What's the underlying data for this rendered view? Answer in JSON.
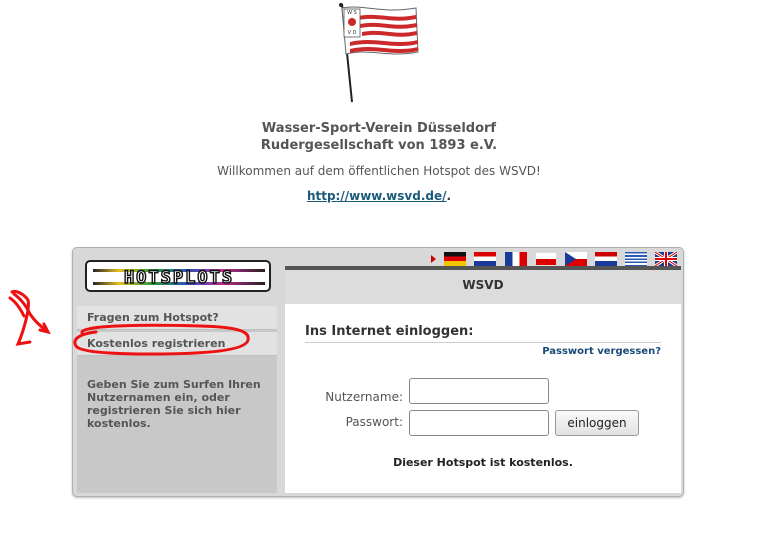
{
  "club": {
    "name_line1": "Wasser-Sport-Verein Düsseldorf",
    "name_line2": "Rudergesellschaft von 1893 e.V.",
    "welcome": "Willkommen auf dem öffentlichen Hotspot des WSVD!",
    "website": "http://www.wsvd.de/",
    "website_suffix": ".",
    "flag_letters": "WSVD"
  },
  "hotspot": {
    "logo_text": "HOTSPLOTS",
    "location_title": "WSVD",
    "languages": [
      "german-flag",
      "croatian-flag",
      "french-flag",
      "polish-flag",
      "czech-flag",
      "dutch-flag",
      "greek-flag",
      "uk-flag"
    ]
  },
  "nav": {
    "items": [
      {
        "label": "Fragen zum Hotspot?"
      },
      {
        "label": "Kostenlos registrieren"
      }
    ],
    "info": "Geben Sie zum Surfen Ihren Nutzernamen ein, oder registrieren Sie sich hier kostenlos."
  },
  "login": {
    "heading": "Ins Internet einloggen:",
    "forgot": "Passwort vergessen?",
    "username_label": "Nutzername:",
    "password_label": "Passwort:",
    "username_value": "",
    "password_value": "",
    "submit_label": "einloggen",
    "free_notice": "Dieser Hotspot ist kostenlos."
  },
  "colors": {
    "flag_red": "#cc2a2a",
    "link": "#1a5a7a",
    "annotation_red": "#ee1111"
  }
}
